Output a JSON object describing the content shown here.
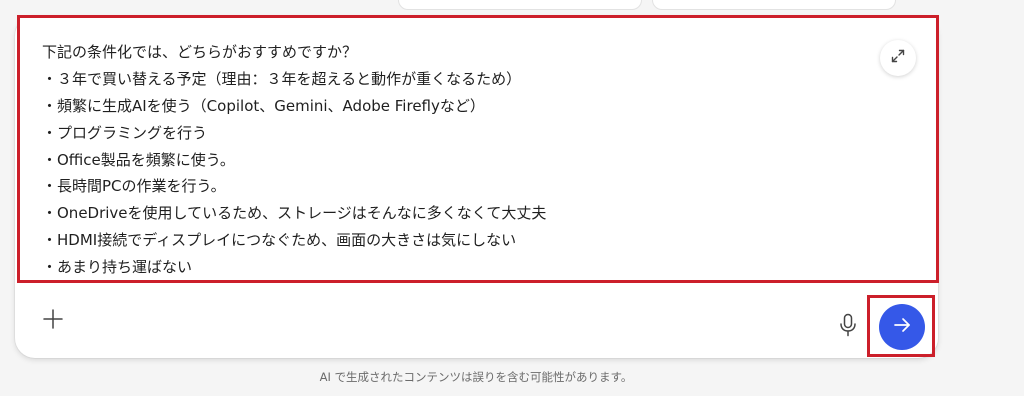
{
  "prompt": {
    "lines": [
      "下記の条件化では、どちらがおすすめですか？",
      "・３年で買い替える予定（理由：３年を超えると動作が重くなるため）",
      "・頻繁に生成AIを使う（Copilot、Gemini、Adobe Fireflyなど）",
      "・プログラミングを行う",
      "・Office製品を頻繁に使う。",
      "・長時間PCの作業を行う。",
      "・OneDriveを使用しているため、ストレージはそんなに多くなくて大丈夫",
      "・HDMI接続でディスプレイにつなぐため、画面の大きさは気にしない",
      "・あまり持ち運ばない"
    ]
  },
  "icons": {
    "expand": "expand-icon",
    "add": "plus-icon",
    "mic": "microphone-icon",
    "send": "arrow-right-icon"
  },
  "colors": {
    "send_button": "#3558e8",
    "highlight_border": "#cc1f2a"
  },
  "footer": {
    "disclaimer": "AI で生成されたコンテンツは誤りを含む可能性があります。"
  }
}
